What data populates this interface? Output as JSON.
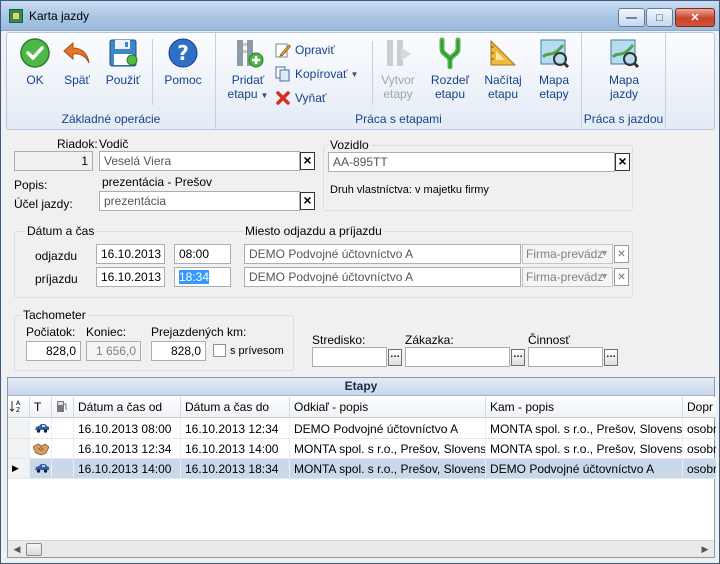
{
  "window": {
    "title": "Karta jazdy"
  },
  "ribbon": {
    "groups": {
      "basic": "Základné operácie",
      "stages": "Práca s etapami",
      "trip": "Práca s jazdou"
    },
    "ok": "OK",
    "back": "Späť",
    "use": "Použiť",
    "help": "Pomoc",
    "add_stage_line1": "Pridať",
    "add_stage_line2": "etapu",
    "edit": "Opraviť",
    "copy": "Kopírovať",
    "remove": "Vyňať",
    "create_stages_line1": "Vytvor",
    "create_stages_line2": "etapy",
    "split_stage_line1": "Rozdeľ",
    "split_stage_line2": "etapu",
    "load_stage_line1": "Načítaj",
    "load_stage_line2": "etapu",
    "map_stages_line1": "Mapa",
    "map_stages_line2": "etapy",
    "map_trip_line1": "Mapa",
    "map_trip_line2": "jazdy"
  },
  "form": {
    "row_label": "Riadok:",
    "row_value": "1",
    "driver_label": "Vodič",
    "driver_value": "Veselá Viera",
    "desc_label": "Popis:",
    "desc_value": "prezentácia - Prešov",
    "purpose_label": "Účel jazdy:",
    "purpose_value": "prezentácia",
    "vehicle_label": "Vozidlo",
    "vehicle_value": "AA-895TT",
    "ownership_text": "Druh vlastníctva: v majetku firmy",
    "datetime_legend": "Dátum a čas",
    "departure_label": "odjazdu",
    "departure_date": "16.10.2013",
    "departure_time": "08:00",
    "arrival_label": "príjazdu",
    "arrival_date": "16.10.2013",
    "arrival_time": "18:34",
    "place_legend": "Miesto odjazdu a príjazdu",
    "departure_place": "DEMO Podvojné účtovníctvo A",
    "departure_place_type": "Firma-prevádz",
    "arrival_place": "DEMO Podvojné účtovníctvo A",
    "arrival_place_type": "Firma-prevádz",
    "tacho_legend": "Tachometer",
    "start_label": "Počiatok:",
    "start_value": "828,0",
    "end_label": "Koniec:",
    "end_value": "1 656,0",
    "driven_label": "Prejazdených km:",
    "driven_value": "828,0",
    "trailer_label": "s prívesom",
    "center_label": "Stredisko:",
    "order_label": "Zákazka:",
    "activity_label": "Činnosť"
  },
  "grid": {
    "title": "Etapy",
    "columns": [
      "T",
      "Dátum a čas od",
      "Dátum a čas do",
      "Odkiaľ - popis",
      "Kam - popis",
      "Dopr"
    ],
    "rows": [
      {
        "icon": "car-icon",
        "from_dt": "16.10.2013  08:00",
        "to_dt": "16.10.2013  12:34",
        "from": "DEMO Podvojné účtovníctvo A",
        "to": "MONTA spol. s r.o., Prešov, Slovensko",
        "transport": "osobn"
      },
      {
        "icon": "handshake-icon",
        "from_dt": "16.10.2013  12:34",
        "to_dt": "16.10.2013  14:00",
        "from": "MONTA spol. s r.o., Prešov, Slovensko",
        "to": "MONTA spol. s r.o., Prešov, Slovensko",
        "transport": "osobn"
      },
      {
        "icon": "car-icon",
        "from_dt": "16.10.2013  14:00",
        "to_dt": "16.10.2013  18:34",
        "from": "MONTA spol. s r.o., Prešov, Slovensko",
        "to": "DEMO Podvojné účtovníctvo A",
        "transport": "osobn"
      }
    ]
  }
}
